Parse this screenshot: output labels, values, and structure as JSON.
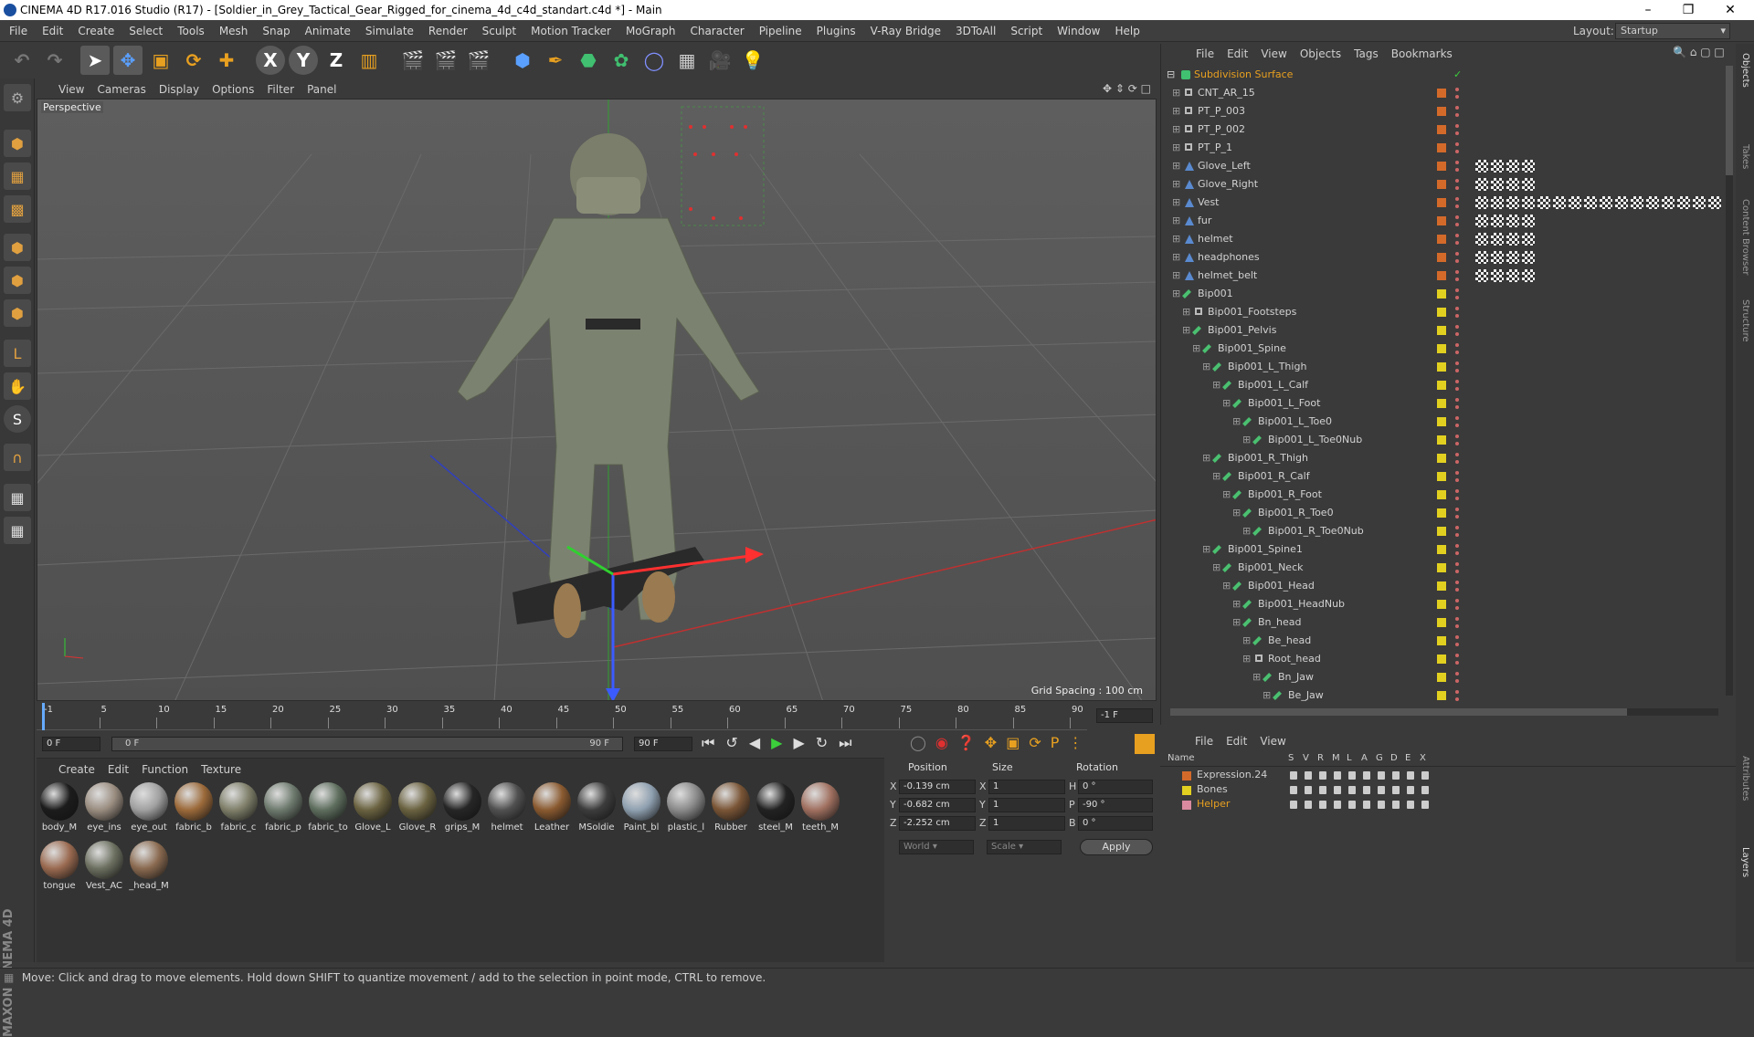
{
  "window": {
    "title": "CINEMA 4D R17.016 Studio (R17) - [Soldier_in_Grey_Tactical_Gear_Rigged_for_cinema_4d_c4d_standart.c4d *] - Main"
  },
  "menu": [
    "File",
    "Edit",
    "Create",
    "Select",
    "Tools",
    "Mesh",
    "Snap",
    "Animate",
    "Simulate",
    "Render",
    "Sculpt",
    "Motion Tracker",
    "MoGraph",
    "Character",
    "Pipeline",
    "Plugins",
    "V-Ray Bridge",
    "3DToAll",
    "Script",
    "Window",
    "Help"
  ],
  "layout": {
    "label": "Layout:",
    "value": "Startup"
  },
  "viewport": {
    "menu": [
      "View",
      "Cameras",
      "Display",
      "Options",
      "Filter",
      "Panel"
    ],
    "camera_label": "Perspective",
    "grid_spacing": "Grid Spacing : 100 cm"
  },
  "timeline": {
    "ticks": [
      "-1",
      "5",
      "10",
      "15",
      "20",
      "25",
      "30",
      "35",
      "40",
      "45",
      "50",
      "55",
      "60",
      "65",
      "70",
      "75",
      "80",
      "85",
      "90"
    ],
    "end_frame": "-1 F",
    "current": "0 F",
    "range_start": "0 F",
    "range_end": "90 F",
    "max": "90 F"
  },
  "materials": {
    "menu": [
      "Create",
      "Edit",
      "Function",
      "Texture"
    ],
    "items": [
      {
        "label": "body_M",
        "color": "#1c1c1c"
      },
      {
        "label": "eye_ins",
        "color": "#9a8d80"
      },
      {
        "label": "eye_out",
        "color": "#a0a0a0"
      },
      {
        "label": "fabric_b",
        "color": "#9c6a3a"
      },
      {
        "label": "fabric_c",
        "color": "#7f7f6a"
      },
      {
        "label": "fabric_p",
        "color": "#6e7a6e"
      },
      {
        "label": "fabric_to",
        "color": "#5e6e5e"
      },
      {
        "label": "Glove_L",
        "color": "#6a6240"
      },
      {
        "label": "Glove_R",
        "color": "#6a6240"
      },
      {
        "label": "grips_M",
        "color": "#262626"
      },
      {
        "label": "helmet",
        "color": "#505050"
      },
      {
        "label": "Leather",
        "color": "#8a5a30"
      },
      {
        "label": "MSoldie",
        "color": "#3c3c3c"
      },
      {
        "label": "Paint_bl",
        "color": "#8fa0b0"
      },
      {
        "label": "plastic_l",
        "color": "#8a8a8a"
      },
      {
        "label": "Rubber",
        "color": "#7a5536"
      },
      {
        "label": "steel_M",
        "color": "#222"
      },
      {
        "label": "teeth_M",
        "color": "#a07060"
      },
      {
        "label": "tongue",
        "color": "#9a6a50"
      },
      {
        "label": "Vest_AC",
        "color": "#6c7060"
      },
      {
        "label": "_head_M",
        "color": "#8a6a50"
      }
    ]
  },
  "attributes": {
    "headers": [
      "Position",
      "Size",
      "Rotation"
    ],
    "rows": [
      {
        "axis": "X",
        "pos": "-0.139 cm",
        "saxis": "X",
        "size": "1",
        "raxis": "H",
        "rot": "0 °"
      },
      {
        "axis": "Y",
        "pos": "-0.682 cm",
        "saxis": "Y",
        "size": "1",
        "raxis": "P",
        "rot": "-90 °"
      },
      {
        "axis": "Z",
        "pos": "-2.252 cm",
        "saxis": "Z",
        "size": "1",
        "raxis": "B",
        "rot": "0 °"
      }
    ],
    "coord_mode": "World",
    "size_mode": "Scale",
    "apply": "Apply"
  },
  "objects": {
    "menu": [
      "File",
      "Edit",
      "View",
      "Objects",
      "Tags",
      "Bookmarks"
    ],
    "root": "Subdivision Surface",
    "rows": [
      {
        "name": "CNT_AR_15",
        "level": 1,
        "type": "null",
        "color": "#d46a2a",
        "tags": 0
      },
      {
        "name": "PT_P_003",
        "level": 1,
        "type": "null",
        "color": "#d46a2a",
        "tags": 0
      },
      {
        "name": "PT_P_002",
        "level": 1,
        "type": "null",
        "color": "#d46a2a",
        "tags": 0
      },
      {
        "name": "PT_P_1",
        "level": 1,
        "type": "null",
        "color": "#d46a2a",
        "tags": 0
      },
      {
        "name": "Glove_Left",
        "level": 1,
        "type": "mesh",
        "color": "#d46a2a",
        "tags": 4
      },
      {
        "name": "Glove_Right",
        "level": 1,
        "type": "mesh",
        "color": "#d46a2a",
        "tags": 4
      },
      {
        "name": "Vest",
        "level": 1,
        "type": "mesh",
        "color": "#d46a2a",
        "tags": 16
      },
      {
        "name": "fur",
        "level": 1,
        "type": "mesh",
        "color": "#d46a2a",
        "tags": 4
      },
      {
        "name": "helmet",
        "level": 1,
        "type": "mesh",
        "color": "#d46a2a",
        "tags": 4
      },
      {
        "name": "headphones",
        "level": 1,
        "type": "mesh",
        "color": "#d46a2a",
        "tags": 4
      },
      {
        "name": "helmet_belt",
        "level": 1,
        "type": "mesh",
        "color": "#d46a2a",
        "tags": 4
      },
      {
        "name": "Bip001",
        "level": 1,
        "type": "bone",
        "color": "#e2d020",
        "tags": 0
      },
      {
        "name": "Bip001_Footsteps",
        "level": 2,
        "type": "null",
        "color": "#e2d020",
        "tags": 0
      },
      {
        "name": "Bip001_Pelvis",
        "level": 2,
        "type": "bone",
        "color": "#e2d020",
        "tags": 0
      },
      {
        "name": "Bip001_Spine",
        "level": 3,
        "type": "bone",
        "color": "#e2d020",
        "tags": 0
      },
      {
        "name": "Bip001_L_Thigh",
        "level": 4,
        "type": "bone",
        "color": "#e2d020",
        "tags": 0
      },
      {
        "name": "Bip001_L_Calf",
        "level": 5,
        "type": "bone",
        "color": "#e2d020",
        "tags": 0
      },
      {
        "name": "Bip001_L_Foot",
        "level": 6,
        "type": "bone",
        "color": "#e2d020",
        "tags": 0
      },
      {
        "name": "Bip001_L_Toe0",
        "level": 7,
        "type": "bone",
        "color": "#e2d020",
        "tags": 0
      },
      {
        "name": "Bip001_L_Toe0Nub",
        "level": 8,
        "type": "bone",
        "color": "#e2d020",
        "tags": 0
      },
      {
        "name": "Bip001_R_Thigh",
        "level": 4,
        "type": "bone",
        "color": "#e2d020",
        "tags": 0
      },
      {
        "name": "Bip001_R_Calf",
        "level": 5,
        "type": "bone",
        "color": "#e2d020",
        "tags": 0
      },
      {
        "name": "Bip001_R_Foot",
        "level": 6,
        "type": "bone",
        "color": "#e2d020",
        "tags": 0
      },
      {
        "name": "Bip001_R_Toe0",
        "level": 7,
        "type": "bone",
        "color": "#e2d020",
        "tags": 0
      },
      {
        "name": "Bip001_R_Toe0Nub",
        "level": 8,
        "type": "bone",
        "color": "#e2d020",
        "tags": 0
      },
      {
        "name": "Bip001_Spine1",
        "level": 4,
        "type": "bone",
        "color": "#e2d020",
        "tags": 0
      },
      {
        "name": "Bip001_Neck",
        "level": 5,
        "type": "bone",
        "color": "#e2d020",
        "tags": 0
      },
      {
        "name": "Bip001_Head",
        "level": 6,
        "type": "bone",
        "color": "#e2d020",
        "tags": 0
      },
      {
        "name": "Bip001_HeadNub",
        "level": 7,
        "type": "bone",
        "color": "#e2d020",
        "tags": 0
      },
      {
        "name": "Bn_head",
        "level": 7,
        "type": "bone",
        "color": "#e2d020",
        "tags": 0
      },
      {
        "name": "Be_head",
        "level": 8,
        "type": "bone",
        "color": "#e2d020",
        "tags": 0
      },
      {
        "name": "Root_head",
        "level": 8,
        "type": "null",
        "color": "#e2d020",
        "tags": 0
      },
      {
        "name": "Bn_Jaw",
        "level": 9,
        "type": "bone",
        "color": "#e2d020",
        "tags": 0
      },
      {
        "name": "Be_Jaw",
        "level": 10,
        "type": "bone",
        "color": "#e2d020",
        "tags": 0
      }
    ]
  },
  "layers": {
    "menu": [
      "File",
      "Edit",
      "View"
    ],
    "columns": [
      "Name",
      "S",
      "V",
      "R",
      "M",
      "L",
      "A",
      "G",
      "D",
      "E",
      "X"
    ],
    "rows": [
      {
        "name": "Expression.24",
        "color": "#d46a2a"
      },
      {
        "name": "Bones",
        "color": "#e2d020"
      },
      {
        "name": "Helper",
        "color": "#d98aa0"
      }
    ]
  },
  "side_tabs": [
    "Objects",
    "Takes",
    "Content Browser",
    "Structure",
    "Attributes",
    "Layers"
  ],
  "status": "Move: Click and drag to move elements. Hold down SHIFT to quantize movement / add to the selection in point mode, CTRL to remove.",
  "brand": "MAXON CINEMA 4D"
}
